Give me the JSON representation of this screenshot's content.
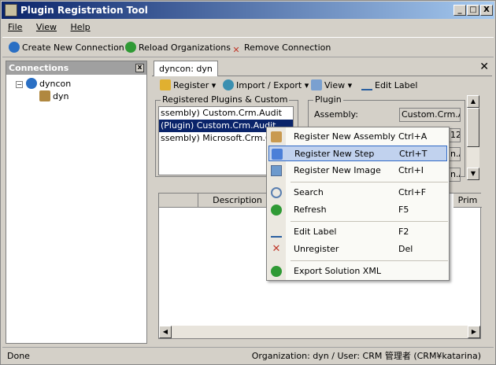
{
  "window": {
    "title": "Plugin Registration Tool",
    "min": "_",
    "max": "□",
    "close": "X"
  },
  "menubar": [
    "File",
    "View",
    "Help"
  ],
  "toolbar": {
    "create": "Create New Connection",
    "reload": "Reload Organizations",
    "remove": "Remove Connection"
  },
  "connections": {
    "header": "Connections",
    "root": "dyncon",
    "child": "dyn"
  },
  "tab": {
    "label": "dyncon: dyn"
  },
  "subtoolbar": {
    "register": "Register",
    "import": "Import / Export",
    "view": "View",
    "edit": "Edit Label"
  },
  "registered": {
    "title": "Registered Plugins & Custom",
    "items": [
      "ssembly) Custom.Crm.Audit",
      "(Plugin) Custom.Crm.Audit",
      "ssembly) Microsoft.Crm.Ob"
    ]
  },
  "plugin": {
    "title": "Plugin",
    "assembly_label": "Assembly:",
    "assembly_value": "Custom.Crm.A",
    "f2": "12",
    "f3": "n.A",
    "f4": "n.A"
  },
  "grid": {
    "col1": "Description",
    "col2": "Prim"
  },
  "status": {
    "left": "Done",
    "right": "Organization: dyn / User: CRM 管理者 (CRM¥katarina)"
  },
  "context_menu": [
    {
      "label": "Register New Assembly",
      "shortcut": "Ctrl+A"
    },
    {
      "label": "Register New Step",
      "shortcut": "Ctrl+T"
    },
    {
      "label": "Register New Image",
      "shortcut": "Ctrl+I"
    },
    {
      "label": "Search",
      "shortcut": "Ctrl+F"
    },
    {
      "label": "Refresh",
      "shortcut": "F5"
    },
    {
      "label": "Edit Label",
      "shortcut": "F2"
    },
    {
      "label": "Unregister",
      "shortcut": "Del"
    },
    {
      "label": "Export Solution XML",
      "shortcut": ""
    }
  ]
}
